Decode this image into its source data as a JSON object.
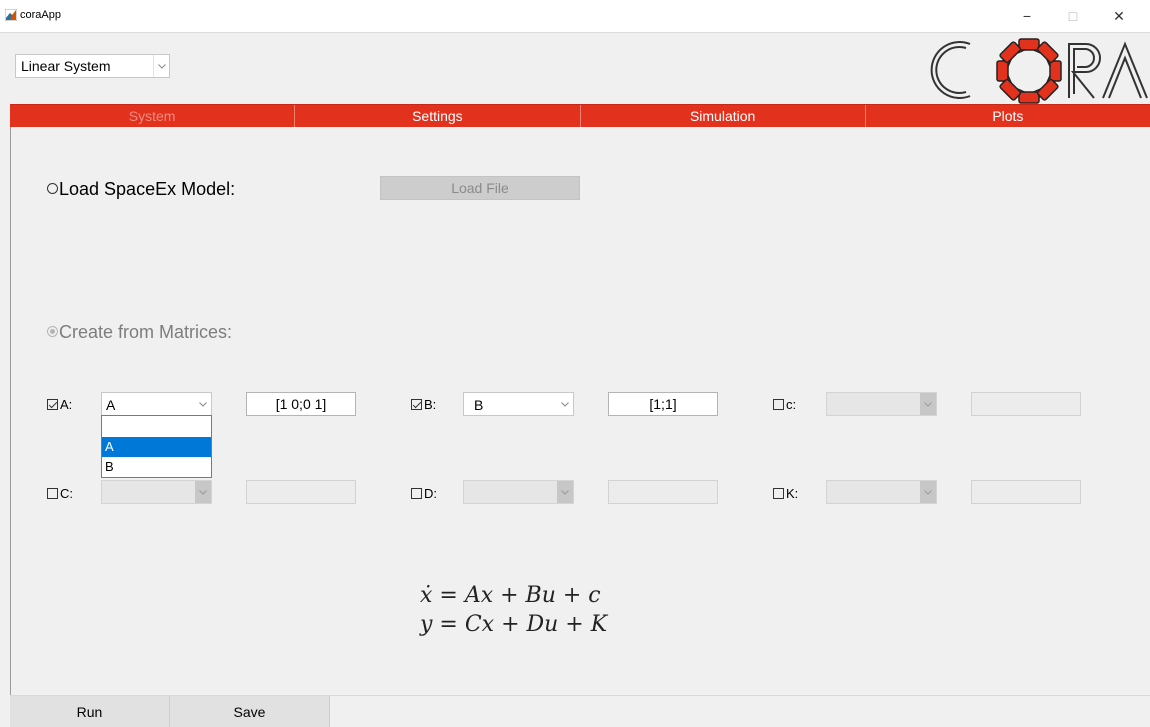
{
  "window": {
    "title": "coraApp",
    "min_glyph": "−",
    "max_glyph": "□",
    "close_glyph": "✕"
  },
  "system_select": {
    "value": "Linear System"
  },
  "logo": {
    "text": "CORA"
  },
  "tabs": [
    {
      "label": "System",
      "disabled": true
    },
    {
      "label": "Settings"
    },
    {
      "label": "Simulation"
    },
    {
      "label": "Plots"
    }
  ],
  "load_option": {
    "label": "Load SpaceEx Model:",
    "button": "Load File"
  },
  "matrix_option": {
    "label": "Create from Matrices:"
  },
  "matrices": {
    "A": {
      "label": "A:",
      "checked": true,
      "selected": "A",
      "value": "[1 0;0 1]",
      "options": [
        "",
        "A",
        "B"
      ]
    },
    "B": {
      "label": "B:",
      "checked": true,
      "selected": "B",
      "value": "[1;1]"
    },
    "c": {
      "label": "c:",
      "checked": false,
      "selected": "",
      "value": ""
    },
    "C": {
      "label": "C:",
      "checked": false,
      "selected": "",
      "value": ""
    },
    "D": {
      "label": "D:",
      "checked": false,
      "selected": "",
      "value": ""
    },
    "K": {
      "label": "K:",
      "checked": false,
      "selected": "",
      "value": ""
    }
  },
  "equations": {
    "line1": "ẋ = Ax + Bu + c",
    "line2": "y = Cx + Du + K"
  },
  "footer": {
    "run": "Run",
    "save": "Save"
  },
  "colors": {
    "accent": "#e2321e",
    "selection": "#0078d7"
  }
}
